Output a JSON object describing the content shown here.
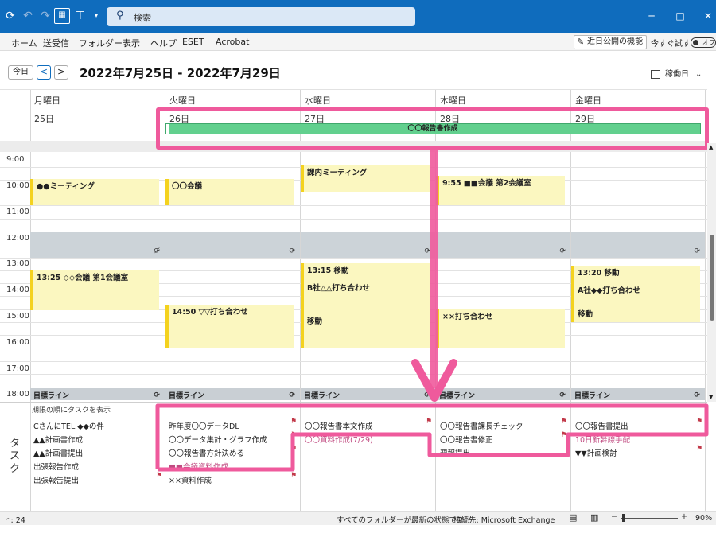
{
  "titlebar": {
    "search_placeholder": "検索",
    "minimize": "─",
    "maximize": "□",
    "close": "✕"
  },
  "menu": {
    "items": [
      "ホーム",
      "送受信",
      "フォルダー",
      "表示",
      "ヘルプ",
      "ESET",
      "Acrobat"
    ],
    "feature_label": "近日公開の機能",
    "try_label": "今すぐ試す",
    "toggle_label": "オフ"
  },
  "calendar": {
    "today_label": "今日",
    "prev": "<",
    "next": ">",
    "range": "2022年7月25日 - 2022年7月29日",
    "view_label": "稼働日",
    "days": [
      {
        "name": "月曜日",
        "num": "25日"
      },
      {
        "name": "火曜日",
        "num": "26日"
      },
      {
        "name": "水曜日",
        "num": "27日"
      },
      {
        "name": "木曜日",
        "num": "28日"
      },
      {
        "name": "金曜日",
        "num": "29日"
      }
    ],
    "allday_event": "〇〇報告書作成",
    "times": [
      "9:00",
      "10:00",
      "11:00",
      "12:00",
      "13:00",
      "14:00",
      "15:00",
      "16:00",
      "17:00",
      "18:00"
    ],
    "events": {
      "mon_meeting": "●●ミーティング",
      "mon_conf": "13:25  ◇◇会議   第1会議室",
      "tue_meeting": "〇〇会議",
      "tue_meet2": "14:50  ▽▽打ち合わせ",
      "wed_meeting": "課内ミーティング",
      "wed_move_a": "13:15  移動",
      "wed_meet": "B社△△打ち合わせ",
      "wed_move_b": "移動",
      "thu_conf": "9:55  ■■会議  第2会議室",
      "thu_meet": "××打ち合わせ",
      "fri_move_a": "13:20  移動",
      "fri_meet": "A社◆◆打ち合わせ",
      "fri_move_b": "移動"
    },
    "goal_label": "目標ライン"
  },
  "tasks": {
    "label": "タスク",
    "sort_label": "期限の順にタスクを表示",
    "mon": [
      "CさんにTEL ◆◆の件",
      "▲▲計画書作成",
      "▲▲計画書提出",
      "出張報告作成",
      "出張報告提出"
    ],
    "tue": [
      "昨年度〇〇データDL",
      "〇〇データ集計・グラフ作成",
      "〇〇報告書方針決める",
      "■■会議資料作成",
      "××資料作成"
    ],
    "wed": [
      "〇〇報告書本文作成",
      "〇〇資料作成(7/29)"
    ],
    "thu": [
      "〇〇報告書課長チェック",
      "〇〇報告書修正",
      "週報提出"
    ],
    "fri": [
      "〇〇報告書提出",
      "10日新幹線手配",
      "▼▼計画検討"
    ]
  },
  "status": {
    "count": "ｒ: 24",
    "sync_state": "すべてのフォルダーが最新の状態です。",
    "connection": "接続先: Microsoft Exchange",
    "zoom": "90%"
  },
  "colors": {
    "accent": "#0f6cbd",
    "event_bg": "#fbf7c0",
    "event_bar": "#f4d21e",
    "allday": "#62d08e",
    "highlight": "#ef5a9c"
  }
}
